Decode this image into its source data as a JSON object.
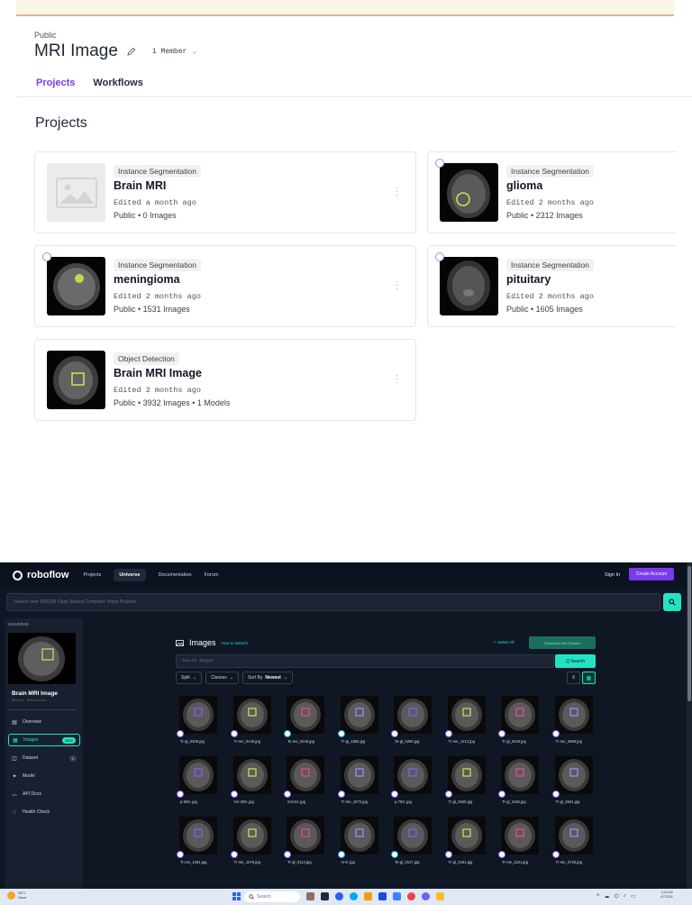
{
  "workspace": {
    "visibility": "Public",
    "title": "MRI Image",
    "members": "1 Member"
  },
  "tabs": [
    {
      "label": "Projects",
      "active": true
    },
    {
      "label": "Workflows",
      "active": false
    }
  ],
  "section_title": "Projects",
  "projects": [
    {
      "type": "Instance Segmentation",
      "name": "Brain MRI",
      "edited": "Edited a month ago",
      "meta": "Public • 0 Images"
    },
    {
      "type": "Instance Segmentation",
      "name": "glioma",
      "edited": "Edited 2 months ago",
      "meta": "Public • 2312 Images"
    },
    {
      "type": "Instance Segmentation",
      "name": "meningioma",
      "edited": "Edited 2 months ago",
      "meta": "Public • 1531 Images"
    },
    {
      "type": "Instance Segmentation",
      "name": "pituitary",
      "edited": "Edited 2 months ago",
      "meta": "Public • 1605 Images"
    },
    {
      "type": "Object Detection",
      "name": "Brain MRI Image",
      "edited": "Edited 2 months ago",
      "meta": "Public • 3932 Images • 1 Models"
    }
  ],
  "roboflow": {
    "brand": "roboflow",
    "nav": [
      {
        "label": "Projects",
        "active": false
      },
      {
        "label": "Universe",
        "active": true
      },
      {
        "label": "Documentation",
        "active": false
      },
      {
        "label": "Forum",
        "active": false
      }
    ],
    "sign_in": "Sign In",
    "create_account": "Create Account",
    "search_placeholder": "Search over 500,000 Open Source Computer Vision Projects",
    "sidebar": {
      "label": "UNIVERSE",
      "project_title": "Brain MRI Image",
      "project_sub": "Object Detection",
      "items": [
        {
          "label": "Overview",
          "icon": "grid-icon",
          "glyph": "▤",
          "badge": ""
        },
        {
          "label": "Images",
          "icon": "images-icon",
          "glyph": "▦",
          "badge": "3932",
          "active": true
        },
        {
          "label": "Dataset",
          "icon": "dataset-icon",
          "glyph": "◫",
          "badge": "1"
        },
        {
          "label": "Model",
          "icon": "model-icon",
          "glyph": "✦",
          "badge": ""
        },
        {
          "label": "API Docs",
          "icon": "code-icon",
          "glyph": "</>",
          "badge": ""
        },
        {
          "label": "Health Check",
          "icon": "health-icon",
          "glyph": "♡",
          "badge": ""
        }
      ]
    },
    "images_heading": "Images",
    "how_to_search": "How to Search",
    "select_all": "✓ Select All",
    "download_btn": "Download this Dataset",
    "search_images_placeholder": "Search Images",
    "search_btn": "Q  Search",
    "filters": [
      {
        "label": "Split",
        "bold": ""
      },
      {
        "label": "Classes",
        "bold": ""
      },
      {
        "label": "Sort By",
        "bold": "Newest"
      }
    ],
    "images": [
      "Tr-gl_0206.jpg",
      "Tr-me_0140.jpg",
      "Te-me_0246.jpg",
      "Tr-gi_1556.jpg",
      "Te-gl_0280.jpg",
      "Tr-me_1213.jpg",
      "Tr-gl_0429.jpg",
      "Tr-me_0686.jpg",
      "p-505-.jpg",
      "m2-205-.jpg",
      "m3-64-.jpg",
      "Tr-me_1072.jpg",
      "p-783-.jpg",
      "Tr-gl_0548.jpg",
      "Tr-gl_1195.jpg",
      "Tr-gl_0841.jpg",
      "Tr-me_1251.jpg",
      "Tr-me_1076.jpg",
      "Tr-gl_0114.jpg",
      "m-5-.jpg",
      "Te-gl_0127.jpg",
      "Tr-gl_0181.jpg",
      "Tr-me_1101.jpg",
      "Tr-me_0725.jpg"
    ]
  },
  "taskbar": {
    "weather_temp": "28°C",
    "weather_desc": "Haze",
    "search": "Search",
    "time": "3:43 AM",
    "date": "4/7/2024"
  },
  "colors": {
    "accent": "#7c3aed",
    "teal": "#22e4c3",
    "dark_bg": "#0f1624"
  }
}
